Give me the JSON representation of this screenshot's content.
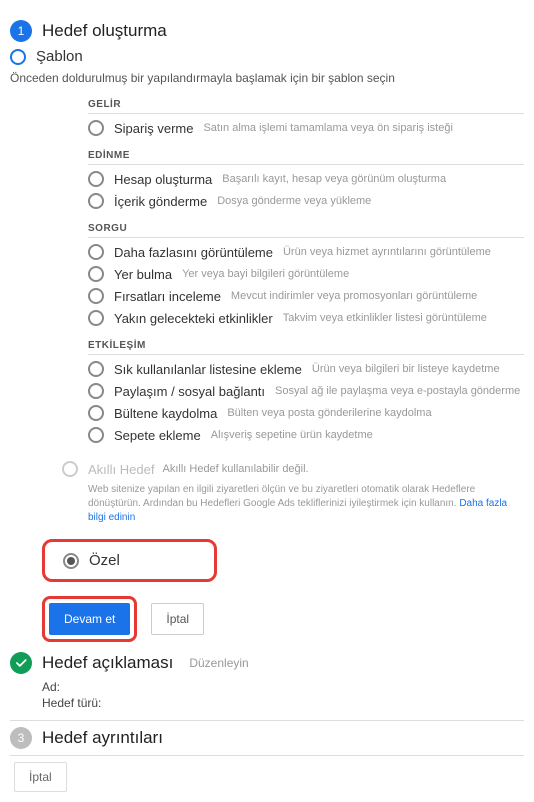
{
  "steps": {
    "create": {
      "num": "1",
      "title": "Hedef oluşturma"
    },
    "describe": {
      "title": "Hedef açıklaması",
      "edit": "Düzenleyin",
      "name_label": "Ad:",
      "type_label": "Hedef türü:"
    },
    "details": {
      "num": "3",
      "title": "Hedef ayrıntıları"
    }
  },
  "template_radio": {
    "label": "Şablon"
  },
  "template_desc": "Önceden doldurulmuş bir yapılandırmayla başlamak için bir şablon seçin",
  "groups": {
    "revenue": {
      "header": "GELİR",
      "items": [
        {
          "label": "Sipariş verme",
          "hint": "Satın alma işlemi tamamlama veya ön sipariş isteği"
        }
      ]
    },
    "acquisition": {
      "header": "EDİNME",
      "items": [
        {
          "label": "Hesap oluşturma",
          "hint": "Başarılı kayıt, hesap veya görünüm oluşturma"
        },
        {
          "label": "İçerik gönderme",
          "hint": "Dosya gönderme veya yükleme"
        }
      ]
    },
    "inquiry": {
      "header": "SORGU",
      "items": [
        {
          "label": "Daha fazlasını görüntüleme",
          "hint": "Ürün veya hizmet ayrıntılarını görüntüleme"
        },
        {
          "label": "Yer bulma",
          "hint": "Yer veya bayi bilgileri görüntüleme"
        },
        {
          "label": "Fırsatları inceleme",
          "hint": "Mevcut indirimler veya promosyonları görüntüleme"
        },
        {
          "label": "Yakın gelecekteki etkinlikler",
          "hint": "Takvim veya etkinlikler listesi görüntüleme"
        }
      ]
    },
    "engagement": {
      "header": "ETKİLEŞİM",
      "items": [
        {
          "label": "Sık kullanılanlar listesine ekleme",
          "hint": "Ürün veya bilgileri bir listeye kaydetme"
        },
        {
          "label": "Paylaşım / sosyal bağlantı",
          "hint": "Sosyal ağ ile paylaşma veya e-postayla gönderme"
        },
        {
          "label": "Bültene kaydolma",
          "hint": "Bülten veya posta gönderilerine kaydolma"
        },
        {
          "label": "Sepete ekleme",
          "hint": "Alışveriş sepetine ürün kaydetme"
        }
      ]
    }
  },
  "smart_goal": {
    "label": "Akıllı Hedef",
    "hint": "Akıllı Hedef kullanılabilir değil.",
    "desc": "Web sitenize yapılan en ilgili ziyaretleri ölçün ve bu ziyaretleri otomatik olarak Hedeflere dönüştürün. Ardından bu Hedefleri Google Ads tekliflerinizi iyileştirmek için kullanın. ",
    "link": "Daha fazla bilgi edinin"
  },
  "custom_radio": {
    "label": "Özel"
  },
  "buttons": {
    "continue": "Devam et",
    "cancel": "İptal"
  }
}
